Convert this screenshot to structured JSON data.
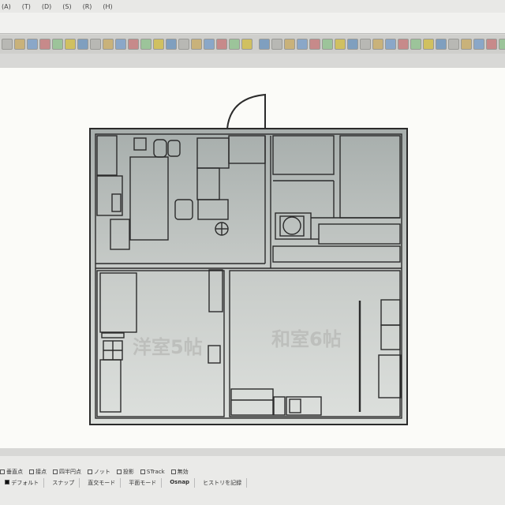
{
  "menubar": {
    "items": [
      "(A)",
      "(T)",
      "(D)",
      "(S)",
      "(R)",
      "(H)"
    ]
  },
  "toolbar": {
    "button_count": 42
  },
  "floorplan": {
    "room_labels": [
      "洋室5帖",
      "和室6帖"
    ]
  },
  "statusbar": {
    "snaps": [
      "垂直点",
      "接点",
      "四半円点",
      "ノット",
      "投影",
      "STrack",
      "無効"
    ],
    "layer": "デフォルト",
    "modes": [
      "スナップ",
      "直交モード",
      "平面モード",
      "Osnap",
      "ヒストリを記録"
    ]
  },
  "colors": {
    "viewport": "#fbfbf8",
    "plan_fill_top": "#a7aeac",
    "plan_fill_bottom": "#dde0dd",
    "wall": "#2b2b2b"
  }
}
